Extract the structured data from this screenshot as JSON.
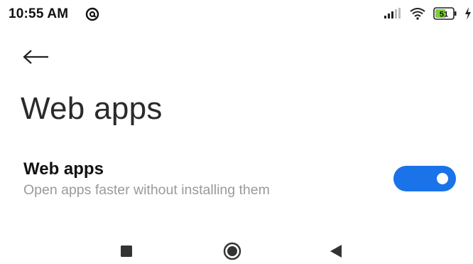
{
  "status_bar": {
    "time": "10:55 AM",
    "left_icon": "at-sign-icon",
    "battery_level": "51",
    "icons": [
      "signal-icon",
      "wifi-icon",
      "battery-icon",
      "charging-icon"
    ]
  },
  "header": {
    "back_icon": "back-arrow-icon",
    "title": "Web apps"
  },
  "setting": {
    "title": "Web apps",
    "subtitle": "Open apps faster without installing them",
    "toggle_on": true
  },
  "colors": {
    "accent": "#1a73e8",
    "subtitle": "#9a9a9a",
    "title": "#2a2a2a"
  },
  "nav_bar": {
    "buttons": [
      "recents-icon",
      "home-icon",
      "back-icon"
    ]
  }
}
